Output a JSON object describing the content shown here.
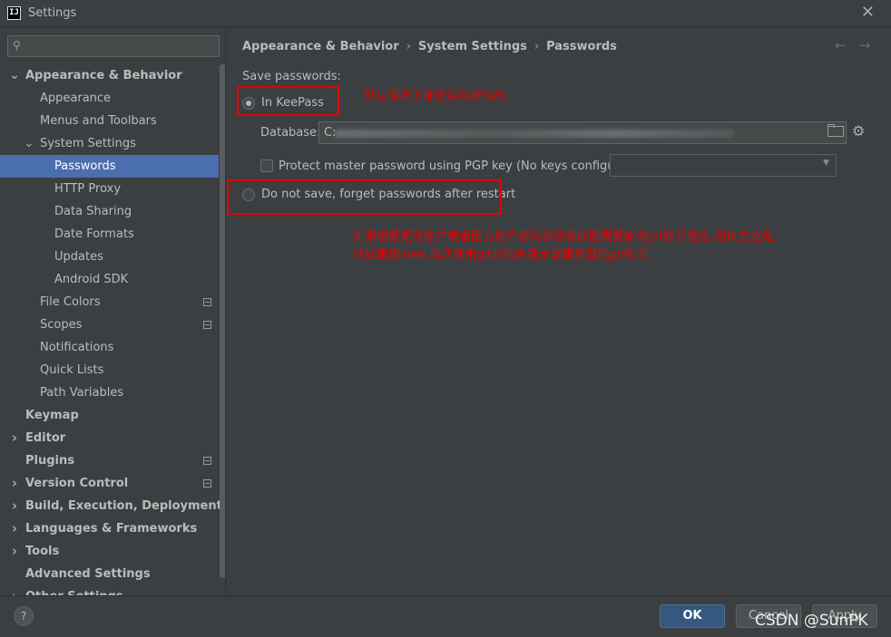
{
  "window": {
    "title": "Settings",
    "logo": "IJ",
    "close_icon": "close-icon"
  },
  "search": {
    "placeholder": "",
    "icon": "search-icon"
  },
  "tree": [
    {
      "label": "Appearance & Behavior",
      "bold": true,
      "expanded": true,
      "depth": 0
    },
    {
      "label": "Appearance",
      "depth": 1
    },
    {
      "label": "Menus and Toolbars",
      "depth": 1
    },
    {
      "label": "System Settings",
      "depth": 1,
      "expanded": true
    },
    {
      "label": "Passwords",
      "depth": 2,
      "selected": true
    },
    {
      "label": "HTTP Proxy",
      "depth": 2
    },
    {
      "label": "Data Sharing",
      "depth": 2
    },
    {
      "label": "Date Formats",
      "depth": 2
    },
    {
      "label": "Updates",
      "depth": 2
    },
    {
      "label": "Android SDK",
      "depth": 2
    },
    {
      "label": "File Colors",
      "depth": 1,
      "badge": true
    },
    {
      "label": "Scopes",
      "depth": 1,
      "badge": true
    },
    {
      "label": "Notifications",
      "depth": 1
    },
    {
      "label": "Quick Lists",
      "depth": 1
    },
    {
      "label": "Path Variables",
      "depth": 1
    },
    {
      "label": "Keymap",
      "bold": true,
      "depth": 0
    },
    {
      "label": "Editor",
      "bold": true,
      "depth": 0,
      "collapsed": true
    },
    {
      "label": "Plugins",
      "bold": true,
      "depth": 0,
      "badge": true
    },
    {
      "label": "Version Control",
      "bold": true,
      "depth": 0,
      "collapsed": true,
      "badge": true
    },
    {
      "label": "Build, Execution, Deployment",
      "bold": true,
      "depth": 0,
      "collapsed": true
    },
    {
      "label": "Languages & Frameworks",
      "bold": true,
      "depth": 0,
      "collapsed": true
    },
    {
      "label": "Tools",
      "bold": true,
      "depth": 0,
      "collapsed": true
    },
    {
      "label": "Advanced Settings",
      "bold": true,
      "depth": 0
    },
    {
      "label": "Other Settings",
      "bold": true,
      "depth": 0,
      "collapsed": true
    }
  ],
  "breadcrumb": {
    "part1": "Appearance & Behavior",
    "part2": "System Settings",
    "part3": "Passwords",
    "sep": "›"
  },
  "nav": {
    "back": "←",
    "forward": "→"
  },
  "passwords": {
    "save_label": "Save passwords:",
    "keepass_label": "In KeePass",
    "keepass_selected": true,
    "database_label": "Database:",
    "database_value": "C:",
    "protect_label": "Protect master password using PGP key (No keys configured)",
    "protect_checked": false,
    "combo_value": "",
    "donotsave_label": "Do not save, forget passwords after restart",
    "donotsave_selected": false
  },
  "annotations": {
    "default_note": "默认情况下都是保存密码的",
    "change_note_line1": "如果想要更改账户或者因为账户密码修改等原因需要修改git账号信息,则点击此处,",
    "change_note_line2": "然后重启idea,再次使用git时则会提示您重新登陆git账号",
    "color": "#e60000"
  },
  "footer": {
    "help": "?",
    "ok": "OK",
    "cancel": "Cancel",
    "apply": "Apply",
    "watermark": "CSDN @SunPK"
  },
  "colors": {
    "background": "#3c3f41",
    "selection": "#4b6eaf",
    "ok_button": "#365880"
  }
}
